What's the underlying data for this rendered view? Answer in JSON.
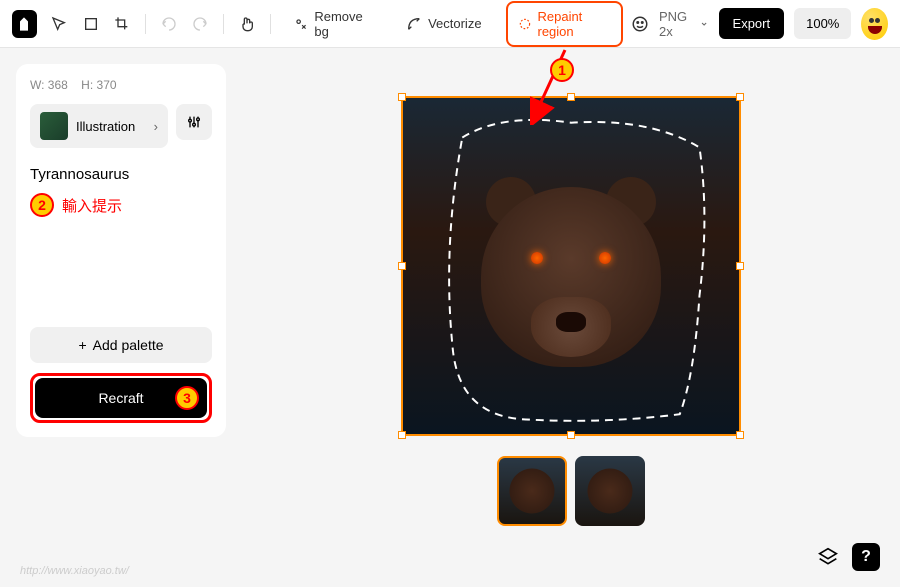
{
  "toolbar": {
    "remove_bg": "Remove bg",
    "vectorize": "Vectorize",
    "repaint_region": "Repaint region",
    "format": "PNG 2x",
    "export": "Export",
    "zoom": "100%"
  },
  "sidebar": {
    "width_label": "W:",
    "width_value": "368",
    "height_label": "H:",
    "height_value": "370",
    "style": "Illustration",
    "prompt": "Tyrannosaurus",
    "add_palette": "Add palette",
    "recraft": "Recraft"
  },
  "annotations": {
    "badge_1": "1",
    "badge_2": "2",
    "text_2": "輸入提示",
    "badge_3": "3"
  },
  "watermark": "http://www.xiaoyao.tw/"
}
